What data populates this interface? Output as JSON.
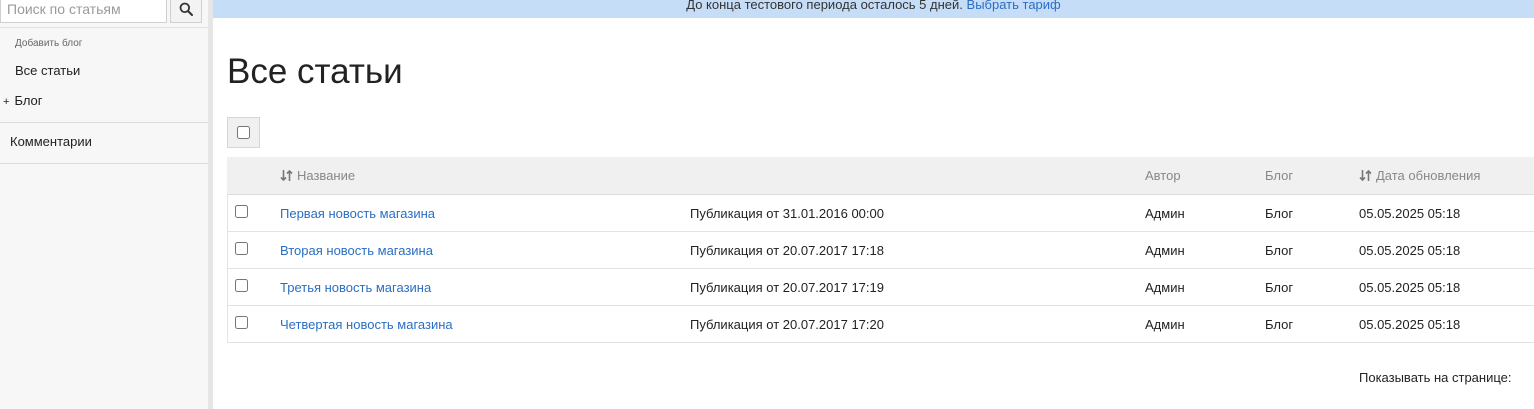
{
  "sidebar": {
    "search_placeholder": "Поиск по статьям",
    "add_blog": "Добавить блог",
    "all_articles": "Все статьи",
    "blog_plus": "+",
    "blog": "Блог",
    "comments": "Комментарии"
  },
  "banner": {
    "text": "До конца тестового периода осталось 5 дней.",
    "link": "Выбрать тариф"
  },
  "main": {
    "title": "Все статьи"
  },
  "table": {
    "headers": {
      "name": "Название",
      "author": "Автор",
      "blog": "Блог",
      "updated": "Дата обновления"
    },
    "rows": [
      {
        "title": "Первая новость магазина",
        "published": "Публикация от 31.01.2016 00:00",
        "author": "Админ",
        "blog": "Блог",
        "updated": "05.05.2025 05:18"
      },
      {
        "title": "Вторая новость магазина",
        "published": "Публикация от 20.07.2017 17:18",
        "author": "Админ",
        "blog": "Блог",
        "updated": "05.05.2025 05:18"
      },
      {
        "title": "Третья новость магазина",
        "published": "Публикация от 20.07.2017 17:19",
        "author": "Админ",
        "blog": "Блог",
        "updated": "05.05.2025 05:18"
      },
      {
        "title": "Четвертая новость магазина",
        "published": "Публикация от 20.07.2017 17:20",
        "author": "Админ",
        "blog": "Блог",
        "updated": "05.05.2025 05:18"
      }
    ]
  },
  "footer": {
    "per_page_label": "Показывать на странице:"
  },
  "colors": {
    "link": "#2a6ec4",
    "banner_bg": "#c6ddf7",
    "sidebar_bg": "#f7f7f7"
  }
}
